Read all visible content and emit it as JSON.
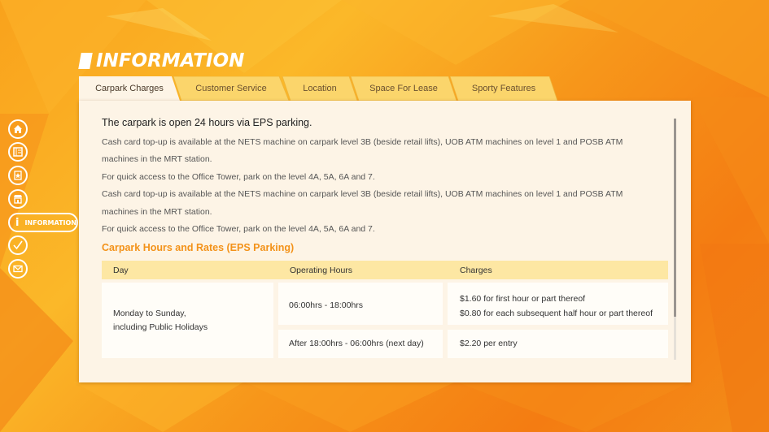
{
  "page": {
    "title": "INFORMATION"
  },
  "colors": {
    "accent": "#f39219",
    "panel_bg": "#fdf4e6",
    "tab_active": "#fdf4e6",
    "tab_inactive": "#fbd56b",
    "table_header": "#fde7a3"
  },
  "nav": {
    "items": [
      {
        "icon": "home-icon"
      },
      {
        "icon": "directory-icon"
      },
      {
        "icon": "star-icon"
      },
      {
        "icon": "store-icon"
      },
      {
        "icon": "info-icon",
        "label": "INFORMATION",
        "active": true
      },
      {
        "icon": "check-icon"
      },
      {
        "icon": "mail-icon"
      }
    ]
  },
  "tabs": [
    {
      "label": "Carpark Charges",
      "active": true
    },
    {
      "label": "Customer Service",
      "active": false
    },
    {
      "label": "Location",
      "active": false
    },
    {
      "label": "Space For Lease",
      "active": false
    },
    {
      "label": "Sporty Features",
      "active": false
    }
  ],
  "content": {
    "headline": "The carpark is open 24 hours via EPS parking.",
    "paragraphs": [
      "Cash card top-up is available at the NETS machine on carpark level 3B (beside retail lifts), UOB ATM machines on level 1 and POSB ATM",
      "machines in the MRT station.",
      "For quick access to the Office Tower, park on the level 4A, 5A, 6A and 7.",
      "Cash card top-up is available at the NETS machine on carpark level 3B (beside retail lifts), UOB ATM machines on level 1 and POSB ATM",
      "machines in the MRT station.",
      "For quick access to the Office Tower, park on the level 4A, 5A, 6A and 7."
    ],
    "section_title": "Carpark Hours and Rates (EPS Parking)"
  },
  "table": {
    "headers": [
      "Day",
      "Operating Hours",
      "Charges"
    ],
    "day_line1": "Monday to Sunday,",
    "day_line2": "including Public Holidays",
    "rows": [
      {
        "hours": "06:00hrs - 18:00hrs",
        "charge_line1": "$1.60 for first hour or part thereof",
        "charge_line2": "$0.80 for each subsequent half hour or part thereof"
      },
      {
        "hours": "After 18:00hrs - 06:00hrs (next day)",
        "charge_line1": "$2.20 per entry"
      }
    ]
  }
}
